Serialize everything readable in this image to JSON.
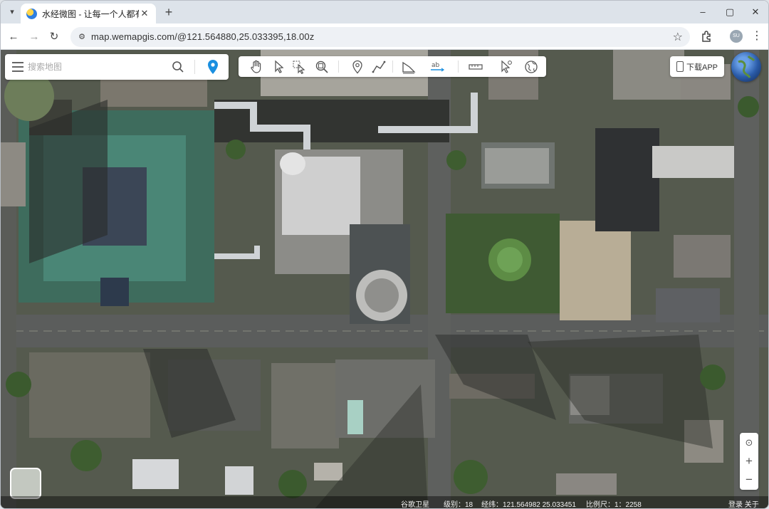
{
  "browser": {
    "tab": {
      "title": "水经微图 - 让每一个人都有自己",
      "icon": "map-favicon"
    },
    "url": "map.wemapgis.com/@121.564880,25.033395,18.00z",
    "controls": {
      "minimize": "–",
      "maximize": "▢",
      "close": "✕",
      "new_tab": "+",
      "back": "←",
      "forward": "→",
      "reload": "↻",
      "bookmark": "☆",
      "menu": "⋮"
    },
    "profile_initials": "SU"
  },
  "map": {
    "search": {
      "placeholder": "搜索地图",
      "value": ""
    },
    "toolbar_icons": [
      "pan-hand-icon",
      "select-arrow-icon",
      "select-box-icon",
      "zoom-area-icon",
      "marker-icon",
      "polyline-icon",
      "polygon-measure-icon",
      "text-label-icon",
      "ruler-icon",
      "pointer-info-icon",
      "globe-3d-icon"
    ],
    "app_button": "下载APP",
    "zoom_controls": {
      "locate": "⊙",
      "zoom_in": "+",
      "zoom_out": "−"
    },
    "status": {
      "source": "谷歌卫星",
      "level": "级别：18",
      "coordinates": "经纬：121.564982 25.033451",
      "scale": "比例尺：1：2258",
      "corner": "登录  关于"
    }
  }
}
